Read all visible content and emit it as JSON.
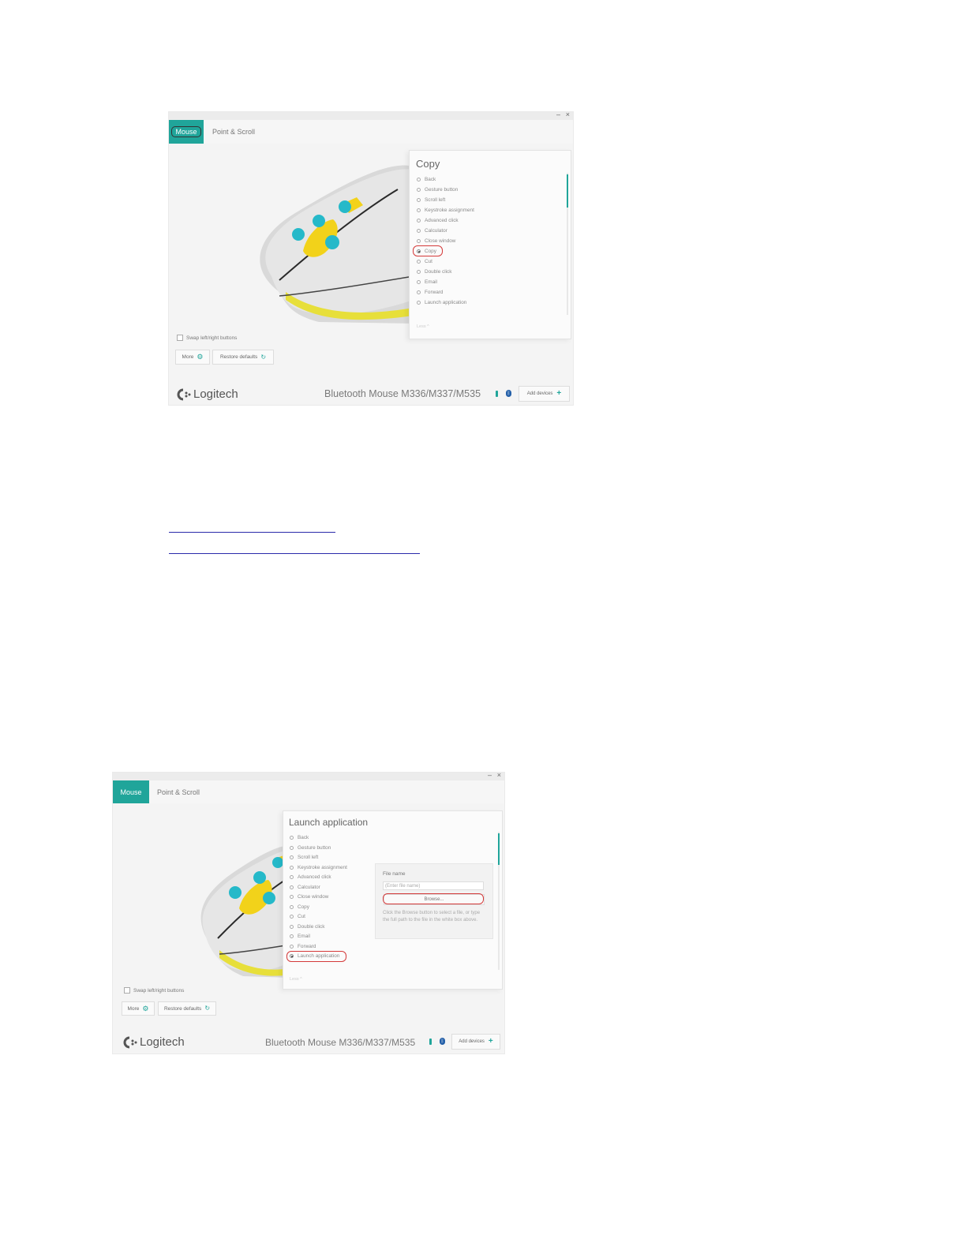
{
  "screenshot1": {
    "window_controls": {
      "minimize": "–",
      "close": "×"
    },
    "tabs": {
      "mouse": "Mouse",
      "point_scroll": "Point & Scroll"
    },
    "panel": {
      "title": "Copy",
      "options": [
        "Back",
        "Gesture button",
        "Scroll left",
        "Keystroke assignment",
        "Advanced click",
        "Calculator",
        "Close window",
        "Copy",
        "Cut",
        "Double click",
        "Email",
        "Forward",
        "Launch application"
      ],
      "selected": "Copy",
      "less": "Less ^"
    },
    "swap_label": "Swap left/right buttons",
    "more_label": "More",
    "restore_label": "Restore defaults",
    "logo_text": "Logitech",
    "device_name": "Bluetooth Mouse M336/M337/M535",
    "add_devices": "Add devices"
  },
  "screenshot2": {
    "window_controls": {
      "minimize": "–",
      "close": "×"
    },
    "tabs": {
      "mouse": "Mouse",
      "point_scroll": "Point & Scroll"
    },
    "panel": {
      "title": "Launch application",
      "options": [
        "Back",
        "Gesture button",
        "Scroll left",
        "Keystroke assignment",
        "Advanced click",
        "Calculator",
        "Close window",
        "Copy",
        "Cut",
        "Double click",
        "Email",
        "Forward",
        "Launch application"
      ],
      "selected": "Launch application",
      "less": "Less ^"
    },
    "file": {
      "label": "File name",
      "placeholder": "(Enter file name)",
      "browse": "Browse...",
      "help": "Click the Browse button to select a file, or type the full path to the file in the white box above."
    },
    "swap_label": "Swap left/right buttons",
    "more_label": "More",
    "restore_label": "Restore defaults",
    "logo_text": "Logitech",
    "device_name": "Bluetooth Mouse M336/M337/M535",
    "add_devices": "Add devices"
  },
  "colors": {
    "accent": "#20a59a",
    "highlight": "#d43a3a",
    "link": "#2a2aaa"
  }
}
